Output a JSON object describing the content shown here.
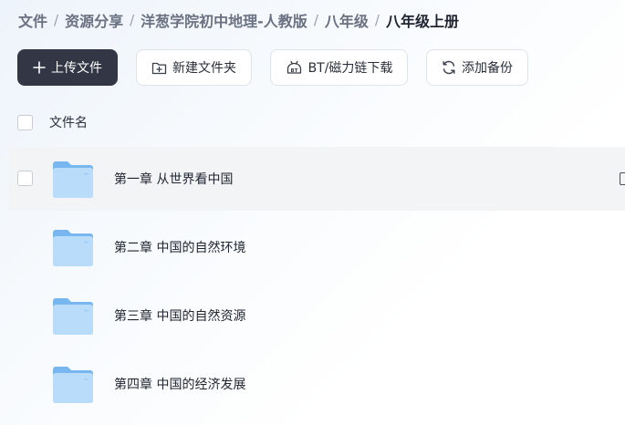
{
  "breadcrumb": {
    "items": [
      "文件",
      "资源分享",
      "洋葱学院初中地理-人教版",
      "八年级",
      "八年级上册"
    ],
    "separator": "/"
  },
  "toolbar": {
    "upload_label": "上传文件",
    "new_folder_label": "新建文件夹",
    "bt_label": "BT/磁力链下载",
    "backup_label": "添加备份"
  },
  "list": {
    "header_name": "文件名",
    "rows": [
      {
        "name": "第一章 从世界看中国",
        "icon": "folder-icon"
      },
      {
        "name": "第二章 中国的自然环境",
        "icon": "folder-icon"
      },
      {
        "name": "第三章 中国的自然资源",
        "icon": "folder-icon"
      },
      {
        "name": "第四章 中国的经济发展",
        "icon": "folder-icon"
      }
    ]
  },
  "colors": {
    "primary_button": "#323645",
    "folder_light": "#b9dcfb",
    "folder_dark": "#78b6ef",
    "hover_row": "#f3f4f6"
  }
}
